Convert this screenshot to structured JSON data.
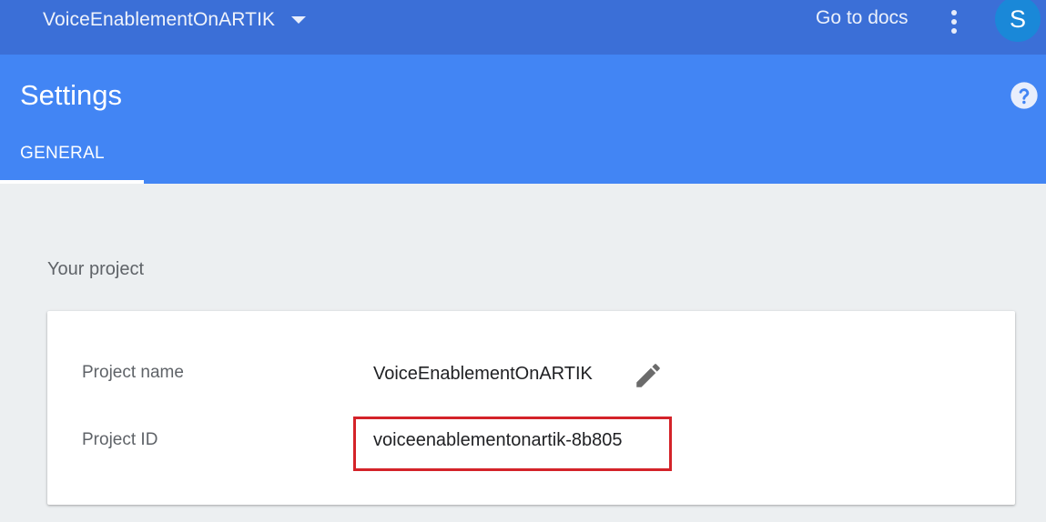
{
  "topbar": {
    "project_name": "VoiceEnablementOnARTIK",
    "docs_link": "Go to docs",
    "avatar_initial": "S"
  },
  "header": {
    "title": "Settings",
    "tabs": [
      {
        "label": "GENERAL",
        "active": true
      }
    ]
  },
  "section": {
    "title": "Your project"
  },
  "project": {
    "name_label": "Project name",
    "name_value": "VoiceEnablementOnARTIK",
    "id_label": "Project ID",
    "id_value": "voiceenablementonartik-8b805"
  },
  "colors": {
    "topbar": "#3b6fd7",
    "header": "#4285f4",
    "avatar": "#1a88d8",
    "highlight": "#d42329",
    "background": "#eceff1"
  },
  "icons": {
    "project_dropdown": "chevron-down-icon",
    "overflow": "more-vert-icon",
    "help": "help-icon",
    "edit": "pencil-icon"
  }
}
